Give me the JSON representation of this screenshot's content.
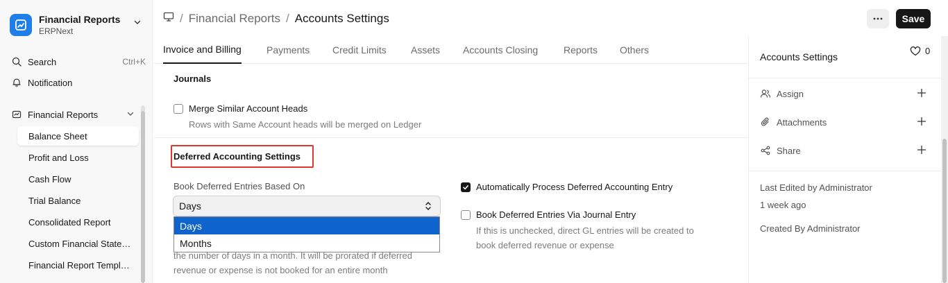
{
  "app": {
    "title": "Financial Reports",
    "subtitle": "ERPNext"
  },
  "sidebar": {
    "search_label": "Search",
    "search_shortcut": "Ctrl+K",
    "notification_label": "Notification",
    "section_label": "Financial Reports",
    "items": [
      {
        "label": "Balance Sheet",
        "active": true
      },
      {
        "label": "Profit and Loss"
      },
      {
        "label": "Cash Flow"
      },
      {
        "label": "Trial Balance"
      },
      {
        "label": "Consolidated Report"
      },
      {
        "label": "Custom Financial Statements"
      },
      {
        "label": "Financial Report Templates"
      }
    ]
  },
  "header": {
    "breadcrumb_parent": "Financial Reports",
    "breadcrumb_current": "Accounts Settings",
    "save_label": "Save"
  },
  "tabs": [
    "Invoice and Billing",
    "Payments",
    "Credit Limits",
    "Assets",
    "Accounts Closing",
    "Reports",
    "Others"
  ],
  "form": {
    "journals_title": "Journals",
    "merge_label": "Merge Similar Account Heads",
    "merge_help": "Rows with Same Account heads will be merged on Ledger",
    "deferred_title": "Deferred Accounting Settings",
    "book_based_on_label": "Book Deferred Entries Based On",
    "book_based_on_value": "Days",
    "book_based_on_options": [
      "Days",
      "Months"
    ],
    "based_on_help_line1": "the number of days in a month. It will be prorated if deferred",
    "based_on_help_line2": "revenue or expense is not booked for an entire month",
    "auto_process_label": "Automatically Process Deferred Accounting Entry",
    "auto_process_checked": true,
    "via_journal_label": "Book Deferred Entries Via Journal Entry",
    "via_journal_checked": false,
    "via_journal_help_line1": "If this is unchecked, direct GL entries will be created to",
    "via_journal_help_line2": "book deferred revenue or expense"
  },
  "right_panel": {
    "title": "Accounts Settings",
    "likes": "0",
    "assign_label": "Assign",
    "attachments_label": "Attachments",
    "share_label": "Share",
    "last_edited": "Last Edited by Administrator",
    "last_edited_time": "1 week ago",
    "created_by": "Created By Administrator"
  },
  "colors": {
    "accent": "#1f7ee8",
    "highlight": "#e0352b",
    "selected_option": "#0f63cc"
  }
}
